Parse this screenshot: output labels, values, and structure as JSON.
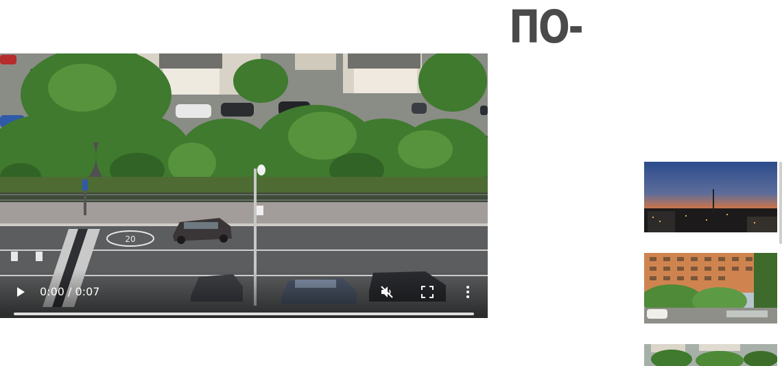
{
  "page": {
    "heading": "ПО-"
  },
  "video": {
    "time_display": "0:00 / 0:07",
    "progress_fraction": 0,
    "muted": true,
    "play_icon": "play-icon",
    "mute_icon": "volume-muted-icon",
    "fullscreen_icon": "fullscreen-icon",
    "more_icon": "more-vertical-icon",
    "road_marking": "20"
  },
  "gallery": {
    "thumbnails": [
      {
        "icon": "sunset-city-thumbnail"
      },
      {
        "icon": "apartment-building-thumbnail"
      },
      {
        "icon": "courtyard-trees-thumbnail"
      }
    ]
  }
}
